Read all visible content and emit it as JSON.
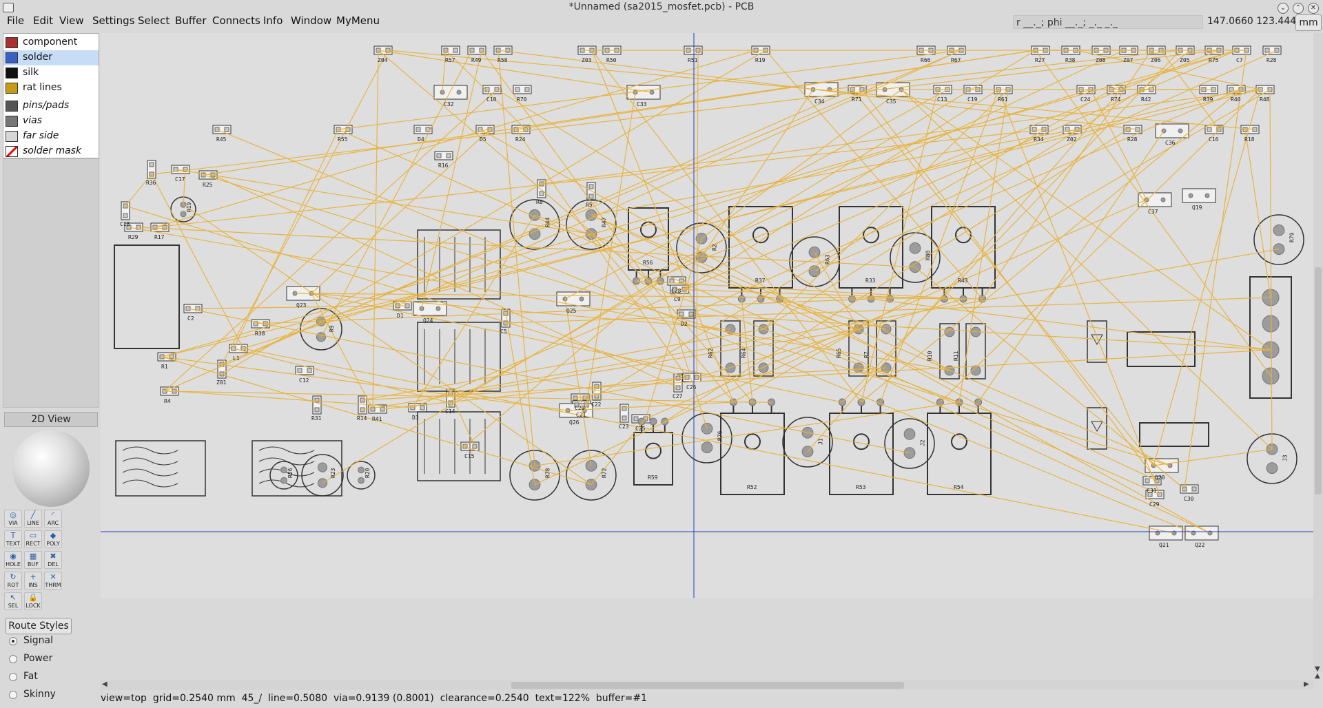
{
  "window": {
    "title": "*Unnamed (sa2015_mosfet.pcb) - PCB"
  },
  "menu": [
    "File",
    "Edit",
    "View",
    "Settings",
    "Select",
    "Buffer",
    "Connects",
    "Info",
    "Window",
    "MyMenu"
  ],
  "coords": {
    "polar": "r __._; phi __._; _._ _._",
    "position": "147.0660 123.4440",
    "unit": "mm"
  },
  "layers": [
    {
      "label": "component",
      "color": "#a8312f",
      "italic": false,
      "selected": false
    },
    {
      "label": "solder",
      "color": "#3a5fc8",
      "italic": false,
      "selected": true
    },
    {
      "label": "silk",
      "color": "#111111",
      "italic": false,
      "selected": false
    },
    {
      "label": "rat lines",
      "color": "#c79b16",
      "italic": false,
      "selected": false
    },
    {
      "label": "pins/pads",
      "color": "#555555",
      "italic": true,
      "selected": false
    },
    {
      "label": "vias",
      "color": "#777777",
      "italic": true,
      "selected": false
    },
    {
      "label": "far side",
      "color": "#d7d7d7",
      "italic": true,
      "selected": false
    },
    {
      "label": "solder mask",
      "color": "#ffffff",
      "italic": true,
      "selected": false
    }
  ],
  "view_button": "2D View",
  "tools": [
    {
      "label": "VIA",
      "icon": "via-icon"
    },
    {
      "label": "LINE",
      "icon": "line-icon"
    },
    {
      "label": "ARC",
      "icon": "arc-icon"
    },
    {
      "label": "TEXT",
      "icon": "text-icon"
    },
    {
      "label": "RECT",
      "icon": "rect-icon"
    },
    {
      "label": "POLY",
      "icon": "poly-icon"
    },
    {
      "label": "HOLE",
      "icon": "hole-icon"
    },
    {
      "label": "BUF",
      "icon": "buffer-icon"
    },
    {
      "label": "DEL",
      "icon": "delete-icon"
    },
    {
      "label": "ROT",
      "icon": "rotate-icon"
    },
    {
      "label": "INS",
      "icon": "insert-icon"
    },
    {
      "label": "THRM",
      "icon": "thermal-icon"
    },
    {
      "label": "SEL",
      "icon": "select-icon"
    },
    {
      "label": "LOCK",
      "icon": "lock-icon"
    }
  ],
  "route_styles": {
    "button": "Route Styles",
    "options": [
      {
        "label": "Signal",
        "selected": true
      },
      {
        "label": "Power",
        "selected": false
      },
      {
        "label": "Fat",
        "selected": false
      },
      {
        "label": "Skinny",
        "selected": false
      }
    ]
  },
  "status": {
    "view": "view=top",
    "grid": "grid=0.2540 mm",
    "angle": "45_/",
    "line": "line=0.5080",
    "via": "via=0.9139 (0.8001)",
    "clearance": "clearance=0.2540",
    "text": "text=122%",
    "buffer": "buffer=#1"
  },
  "board": {
    "refdes": [
      "Z04",
      "R57",
      "R49",
      "R58",
      "Z03",
      "R50",
      "R51",
      "R19",
      "R66",
      "R67",
      "R27",
      "R38",
      "Z08",
      "Z07",
      "Z06",
      "Z05",
      "R75",
      "C7",
      "R28",
      "C10",
      "R70",
      "R71",
      "C13",
      "C19",
      "R61",
      "C24",
      "R74",
      "R42",
      "R39",
      "R40",
      "R48",
      "R45",
      "R55",
      "D4",
      "D5",
      "R24",
      "R34",
      "Z02",
      "R28",
      "C16",
      "R18",
      "R16",
      "R36",
      "C17",
      "R25",
      "C18",
      "R29",
      "R17",
      "R8",
      "R5",
      "C2",
      "R1",
      "R4",
      "Z01",
      "L1",
      "D1",
      "C5",
      "C9",
      "D2",
      "R38",
      "C12",
      "R31",
      "R14",
      "R41",
      "D3",
      "C14",
      "C15",
      "C20",
      "C21",
      "C22",
      "C23",
      "C25",
      "C26",
      "C27",
      "C28",
      "C29",
      "C30",
      "C31",
      "C32",
      "C33",
      "C34",
      "C35",
      "C36",
      "C37",
      "Q19",
      "Q20",
      "Q21",
      "Q22",
      "Q23",
      "Q24",
      "Q25",
      "Q26",
      "R44",
      "R47",
      "R2",
      "R63",
      "R80",
      "R79",
      "R78",
      "R72",
      "R76",
      "J1",
      "J2",
      "J3",
      "R9",
      "R23",
      "R19",
      "R20",
      "R26",
      "R37",
      "R33",
      "R43",
      "R52",
      "R53",
      "R54",
      "R56",
      "R59",
      "R62",
      "R64",
      "R65",
      "R7",
      "R10",
      "R11",
      "R12",
      "R13",
      "R15",
      "R21",
      "R22"
    ]
  }
}
